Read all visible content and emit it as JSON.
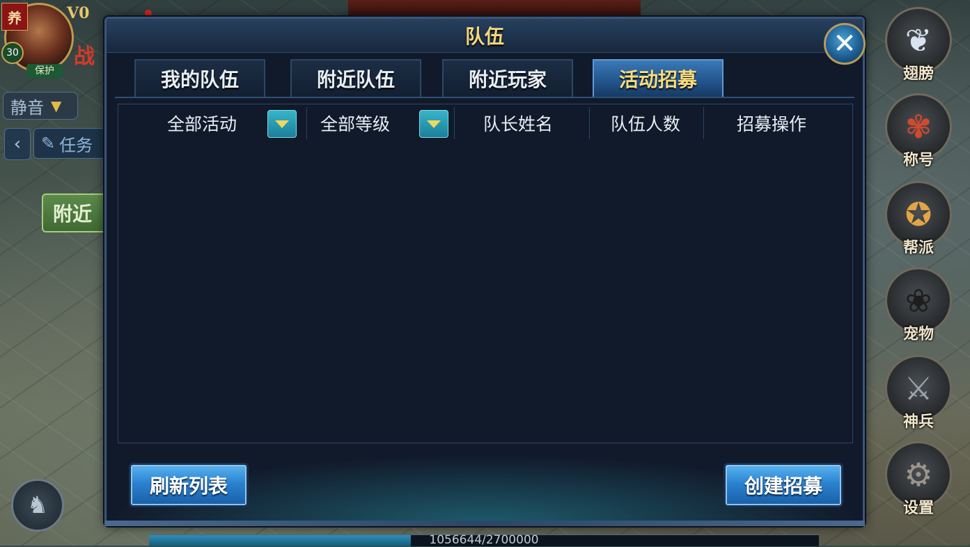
{
  "hud": {
    "raise_badge": "养",
    "vip": "V0",
    "level": "30",
    "protect": "保护",
    "battle_char": "战",
    "mute": "静音",
    "task": "任务",
    "nearby_side": "附近"
  },
  "side_menu": [
    {
      "label": "翅膀",
      "icon": "wing-icon"
    },
    {
      "label": "称号",
      "icon": "title-icon"
    },
    {
      "label": "帮派",
      "icon": "guild-icon"
    },
    {
      "label": "宠物",
      "icon": "paw-icon"
    },
    {
      "label": "神兵",
      "icon": "weapon-icon"
    },
    {
      "label": "设置",
      "icon": "gear-icon"
    }
  ],
  "dialog": {
    "title": "队伍",
    "tabs": [
      {
        "label": "我的队伍",
        "active": false
      },
      {
        "label": "附近队伍",
        "active": false
      },
      {
        "label": "附近玩家",
        "active": false
      },
      {
        "label": "活动招募",
        "active": true
      }
    ],
    "columns": {
      "activity_filter": "全部活动",
      "level_filter": "全部等级",
      "leader_name": "队长姓名",
      "member_count": "队伍人数",
      "recruit_action": "招募操作"
    },
    "refresh_button": "刷新列表",
    "create_button": "创建招募"
  },
  "exp": {
    "text": "1056644/2700000",
    "fraction": 0.391
  },
  "colors": {
    "accent_gold": "#f3d77c",
    "panel_bg": "#111a2b",
    "tab_active": "#3b79b6",
    "button_blue": "#2b82d0"
  }
}
